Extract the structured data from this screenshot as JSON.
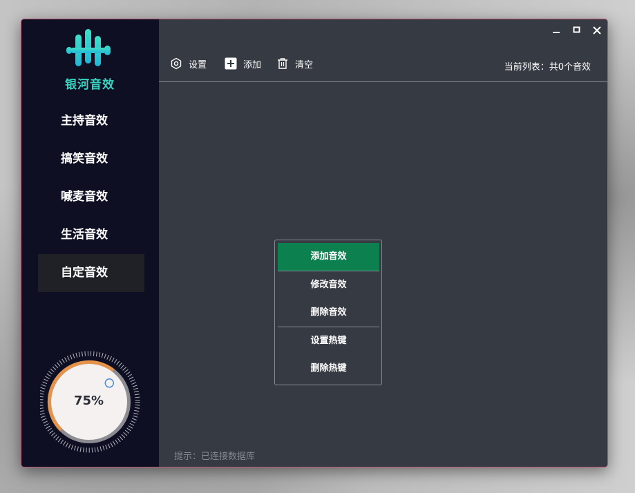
{
  "app": {
    "logo_text": "银河音效"
  },
  "sidebar": {
    "items": [
      {
        "label": "主持音效"
      },
      {
        "label": "搞笑音效"
      },
      {
        "label": "喊麦音效"
      },
      {
        "label": "生活音效"
      },
      {
        "label": "自定音效",
        "active": true
      }
    ]
  },
  "volume": {
    "label": "75%",
    "value": 75
  },
  "toolbar": {
    "settings_label": "设置",
    "add_label": "添加",
    "clear_label": "清空",
    "status": "当前列表：共0个音效"
  },
  "context_menu": {
    "items": [
      {
        "label": "添加音效",
        "selected": true
      },
      {
        "label": "修改音效"
      },
      {
        "label": "删除音效"
      },
      {
        "label": "设置热键"
      },
      {
        "label": "删除热键"
      }
    ]
  },
  "hint": "提示：已连接数据库",
  "colors": {
    "accent": "#0d8050",
    "knob_arc": "#e5924a",
    "logo": "#36d4c1",
    "window_border": "#c45577"
  },
  "icons": {
    "settings": "gear-icon",
    "add": "plus-icon",
    "clear": "trash-icon",
    "window": [
      "minimize-icon",
      "maximize-icon",
      "close-icon"
    ]
  }
}
